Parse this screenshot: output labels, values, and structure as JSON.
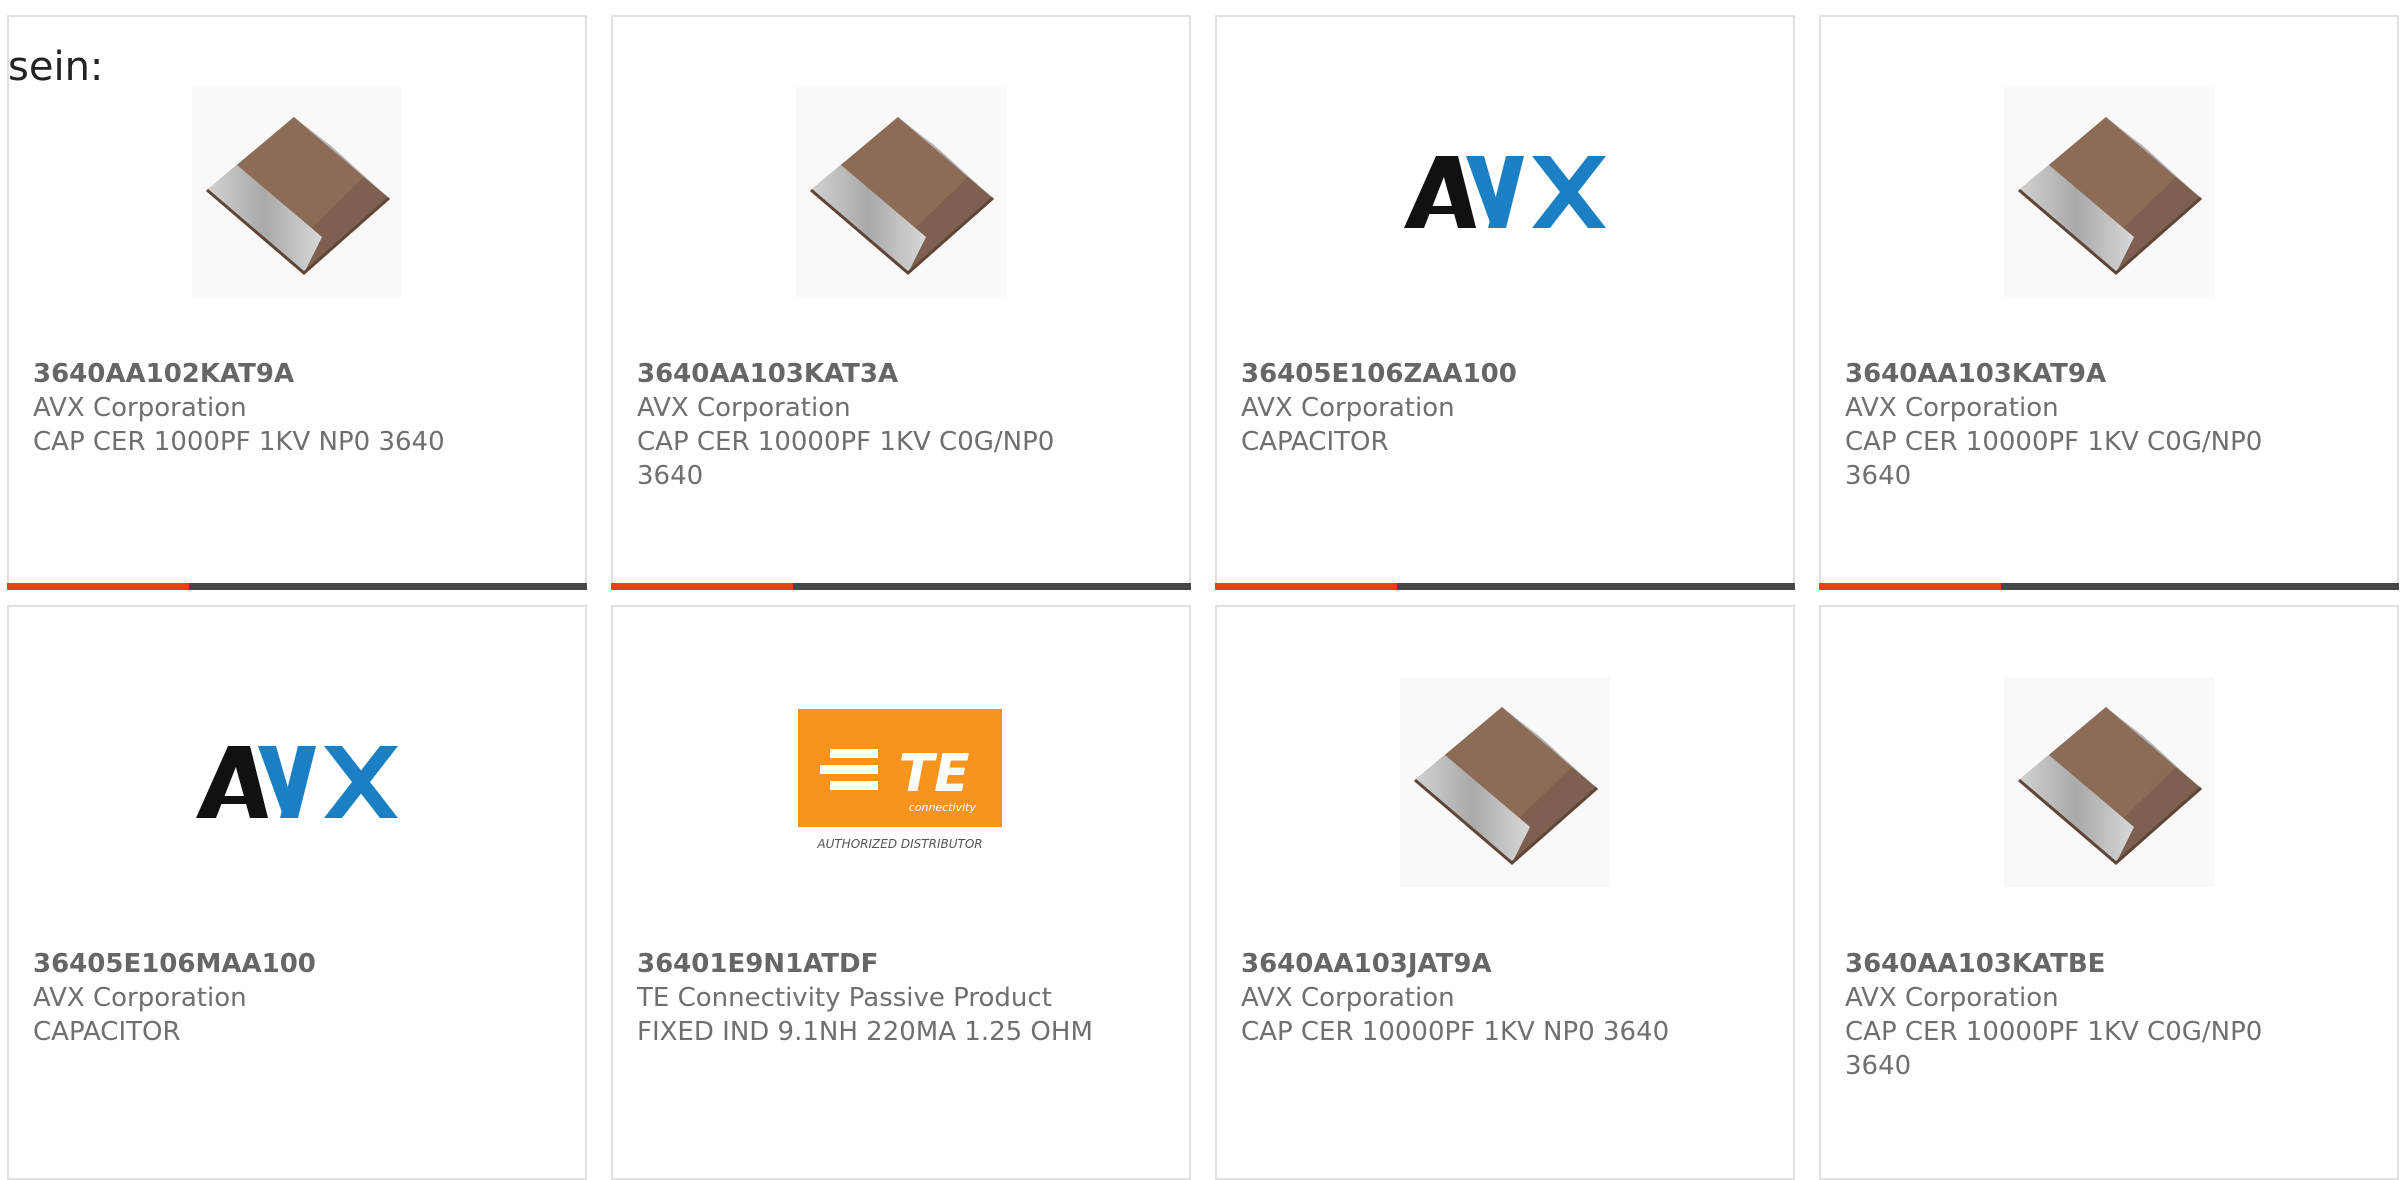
{
  "intro": {
    "text": "sein:"
  },
  "cards": [
    {
      "part_number": "3640AA102KAT9A",
      "manufacturer": "AVX Corporation",
      "description": "CAP CER 1000PF 1KV NP0 3640",
      "image": "capacitor-chip",
      "has_progress_bar": true
    },
    {
      "part_number": "3640AA103KAT3A",
      "manufacturer": "AVX Corporation",
      "description": "CAP CER 10000PF 1KV C0G/NP0 3640",
      "image": "capacitor-chip",
      "has_progress_bar": true
    },
    {
      "part_number": "36405E106ZAA100",
      "manufacturer": "AVX Corporation",
      "description": "CAPACITOR",
      "image": "avx-logo",
      "logo_text": "AVX",
      "has_progress_bar": true
    },
    {
      "part_number": "3640AA103KAT9A",
      "manufacturer": "AVX Corporation",
      "description": "CAP CER 10000PF 1KV C0G/NP0 3640",
      "image": "capacitor-chip",
      "has_progress_bar": true
    },
    {
      "part_number": "36405E106MAA100",
      "manufacturer": "AVX Corporation",
      "description": "CAPACITOR",
      "image": "avx-logo",
      "logo_text": "AVX",
      "has_progress_bar": false
    },
    {
      "part_number": "36401E9N1ATDF",
      "manufacturer": "TE Connectivity Passive Product",
      "description": "FIXED IND 9.1NH 220MA 1.25 OHM",
      "image": "te-logo",
      "logo_text": "TE",
      "logo_subtext": "connectivity",
      "logo_caption": "AUTHORIZED DISTRIBUTOR",
      "has_progress_bar": false
    },
    {
      "part_number": "3640AA103JAT9A",
      "manufacturer": "AVX Corporation",
      "description": "CAP CER 10000PF 1KV NP0 3640",
      "image": "capacitor-chip",
      "has_progress_bar": false
    },
    {
      "part_number": "3640AA103KATBE",
      "manufacturer": "AVX Corporation",
      "description": "CAP CER 10000PF 1KV C0G/NP0 3640",
      "image": "capacitor-chip",
      "has_progress_bar": false
    }
  ],
  "colors": {
    "accent": "#e8401c",
    "bar": "#474747",
    "card_border": "#e1e1e1",
    "text": "#6f6f6f",
    "avx_blue": "#1b7fc4",
    "avx_black": "#111111",
    "te_orange": "#f7941d",
    "chip_body": "#8b6a55",
    "chip_end": "#b9b9b9"
  }
}
